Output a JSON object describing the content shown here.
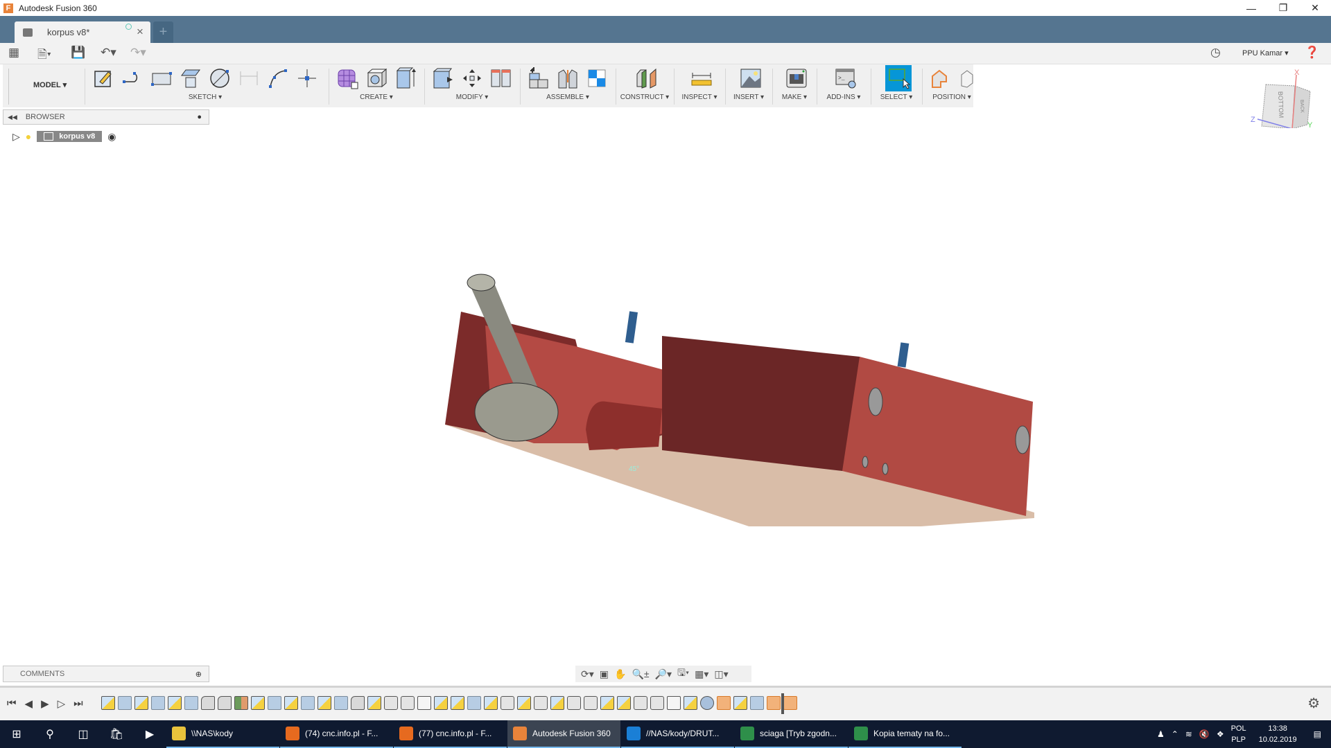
{
  "window": {
    "title": "Autodesk Fusion 360",
    "controls": [
      "minimize",
      "restore",
      "close"
    ]
  },
  "document_tab": {
    "name": "korpus v8*",
    "new_tab_label": "+"
  },
  "quick_access": {
    "user": "PPU Kamar",
    "icons": [
      "grid-icon",
      "file-icon",
      "save-icon",
      "undo-icon",
      "redo-icon",
      "clock-icon",
      "help-icon"
    ]
  },
  "toolbar": {
    "workspace": "MODEL",
    "groups": [
      {
        "label": "SKETCH",
        "icons": [
          "create-sketch-icon",
          "line-icon",
          "rectangle-icon",
          "project-icon",
          "circle-icon",
          "dimension-icon",
          "arc-icon",
          "point-icon"
        ]
      },
      {
        "label": "CREATE",
        "icons": [
          "form-icon",
          "hole-icon",
          "extrude-icon"
        ]
      },
      {
        "label": "MODIFY",
        "icons": [
          "press-pull-icon",
          "move-icon",
          "align-icon"
        ]
      },
      {
        "label": "ASSEMBLE",
        "icons": [
          "new-component-icon",
          "joint-icon",
          "as-built-joint-icon"
        ]
      },
      {
        "label": "CONSTRUCT",
        "icons": [
          "offset-plane-icon"
        ]
      },
      {
        "label": "INSPECT",
        "icons": [
          "measure-icon"
        ]
      },
      {
        "label": "INSERT",
        "icons": [
          "insert-image-icon"
        ]
      },
      {
        "label": "MAKE",
        "icons": [
          "3d-print-icon"
        ]
      },
      {
        "label": "ADD-INS",
        "icons": [
          "scripts-icon"
        ]
      },
      {
        "label": "SELECT",
        "icons": [
          "select-icon"
        ]
      },
      {
        "label": "POSITION",
        "icons": [
          "capture-position-icon",
          "revert-position-icon"
        ]
      }
    ]
  },
  "browser": {
    "title": "BROWSER",
    "root": "korpus v8"
  },
  "comments": {
    "title": "COMMENTS"
  },
  "viewcube": {
    "faces": [
      "BOTTOM",
      "BACK"
    ],
    "axes": [
      "X",
      "Y",
      "Z"
    ]
  },
  "viewport": {
    "annotation": "45°"
  },
  "timeline": {
    "items": [
      "sketch",
      "extrude",
      "sketch",
      "extrude",
      "sketch",
      "extrude",
      "fillet",
      "fillet",
      "plane",
      "sketch",
      "extrude",
      "sketch",
      "extrude",
      "sketch",
      "extrude",
      "fillet",
      "sketch",
      "hole",
      "hole",
      "box",
      "sketch",
      "sketch",
      "extrude",
      "sketch",
      "hole",
      "sketch",
      "hole",
      "sketch",
      "hole",
      "hole",
      "sketch",
      "sketch",
      "hole",
      "hole",
      "box",
      "sketch",
      "revolve",
      "joint",
      "sketch",
      "extrude",
      "joint",
      "joint"
    ]
  },
  "taskbar": {
    "apps": [
      {
        "label": "\\\\NAS\\kody",
        "color": "#e8c23c",
        "active": false
      },
      {
        "label": "(74) cnc.info.pl - F...",
        "color": "#e66a1f",
        "active": false
      },
      {
        "label": "(77) cnc.info.pl - F...",
        "color": "#e66a1f",
        "active": false
      },
      {
        "label": "Autodesk Fusion 360",
        "color": "#e8833a",
        "active": true
      },
      {
        "label": "//NAS/kody/DRUT...",
        "color": "#1a7fd6",
        "active": false
      },
      {
        "label": "sciaga  [Tryb zgodn...",
        "color": "#2e8f4a",
        "active": false
      },
      {
        "label": "Kopia tematy na fo...",
        "color": "#2e8f4a",
        "active": false
      }
    ],
    "language": "POL",
    "layout": "PLP",
    "time": "13:38",
    "date": "10.02.2019"
  }
}
